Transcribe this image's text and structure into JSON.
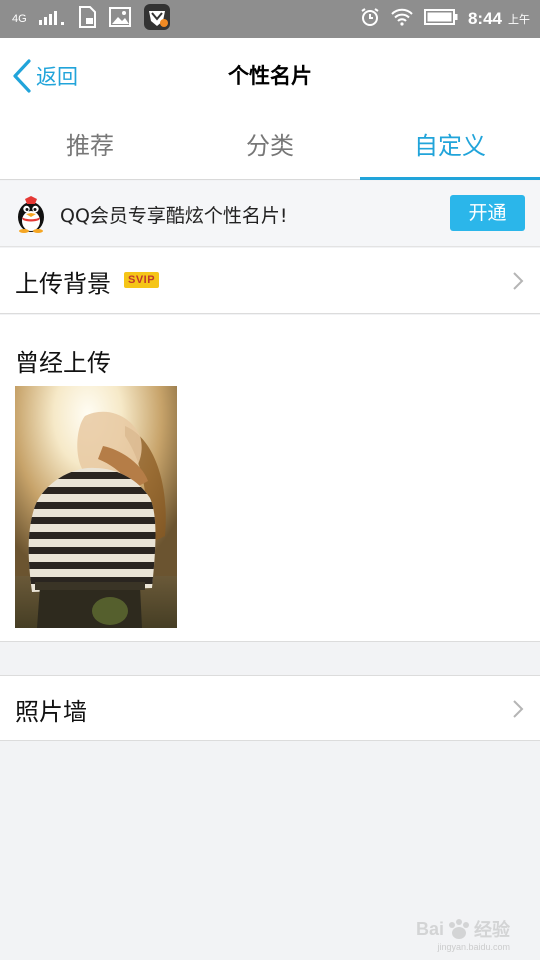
{
  "status_bar": {
    "network": "4G",
    "time": "8:44",
    "ampm": "上午"
  },
  "header": {
    "back_label": "返回",
    "title": "个性名片"
  },
  "tabs": [
    {
      "label": "推荐",
      "active": false
    },
    {
      "label": "分类",
      "active": false
    },
    {
      "label": "自定义",
      "active": true
    }
  ],
  "banner": {
    "text": "QQ会员专享酷炫个性名片!",
    "button_label": "开通"
  },
  "upload_background": {
    "label": "上传背景",
    "badge": "SVIP"
  },
  "history": {
    "title": "曾经上传"
  },
  "photo_wall": {
    "label": "照片墙"
  },
  "watermark": {
    "brand": "Bai",
    "brand_cn": "经验",
    "url": "jingyan.baidu.com"
  },
  "colors": {
    "accent": "#21a4da",
    "button": "#2bb6ea",
    "status_bar": "#8e8e8e"
  }
}
